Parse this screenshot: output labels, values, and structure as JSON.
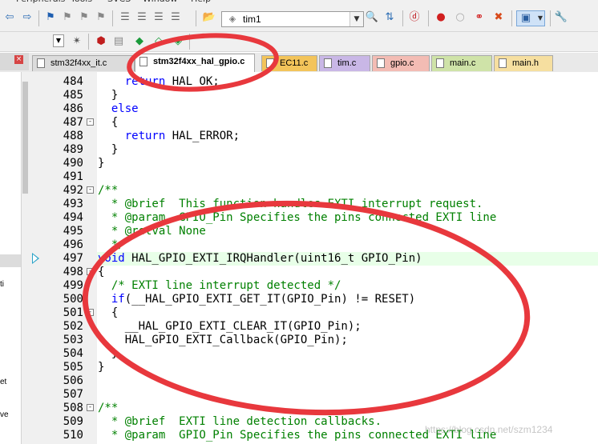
{
  "menubar": [
    "Peripherals",
    "Tools",
    "SVCS",
    "Window",
    "Help"
  ],
  "toolbar": {
    "target_value": "tim1"
  },
  "tabs": [
    {
      "label": "stm32f4xx_it.c",
      "color": "#dcdcdc"
    },
    {
      "label": "stm32f4xx_hal_gpio.c",
      "color": "#ffffff"
    },
    {
      "label": "EC11.c",
      "color": "#f3c45a"
    },
    {
      "label": "tim.c",
      "color": "#c9b7e6"
    },
    {
      "label": "gpio.c",
      "color": "#f3bcb4"
    },
    {
      "label": "main.c",
      "color": "#cfe3a8"
    },
    {
      "label": "main.h",
      "color": "#f6dfa0"
    }
  ],
  "left_panel": {
    "labels": [
      "ti",
      "et",
      "ve"
    ]
  },
  "code": {
    "lines": [
      {
        "n": "484",
        "fold": "",
        "segs": [
          {
            "c": "kw",
            "t": "    return"
          },
          {
            "c": "",
            "t": " HAL_OK;"
          }
        ]
      },
      {
        "n": "485",
        "fold": "",
        "segs": [
          {
            "c": "",
            "t": "  }"
          }
        ]
      },
      {
        "n": "486",
        "fold": "",
        "segs": [
          {
            "c": "kw",
            "t": "  else"
          }
        ]
      },
      {
        "n": "487",
        "fold": "-",
        "segs": [
          {
            "c": "",
            "t": "  {"
          }
        ]
      },
      {
        "n": "488",
        "fold": "",
        "segs": [
          {
            "c": "kw",
            "t": "    return"
          },
          {
            "c": "",
            "t": " HAL_ERROR;"
          }
        ]
      },
      {
        "n": "489",
        "fold": "",
        "segs": [
          {
            "c": "",
            "t": "  }"
          }
        ]
      },
      {
        "n": "490",
        "fold": "",
        "segs": [
          {
            "c": "",
            "t": "}"
          }
        ]
      },
      {
        "n": "491",
        "fold": "",
        "segs": []
      },
      {
        "n": "492",
        "fold": "-",
        "segs": [
          {
            "c": "cm",
            "t": "/**"
          }
        ]
      },
      {
        "n": "493",
        "fold": "",
        "segs": [
          {
            "c": "cm",
            "t": "  * @brief  This function handles EXTI interrupt request."
          }
        ]
      },
      {
        "n": "494",
        "fold": "",
        "segs": [
          {
            "c": "cm",
            "t": "  * @param  GPIO_Pin Specifies the pins connected EXTI line"
          }
        ]
      },
      {
        "n": "495",
        "fold": "",
        "segs": [
          {
            "c": "cm",
            "t": "  * @retval None"
          }
        ]
      },
      {
        "n": "496",
        "fold": "",
        "segs": [
          {
            "c": "cm",
            "t": "  */"
          }
        ]
      },
      {
        "n": "497",
        "fold": "",
        "hl": true,
        "segs": [
          {
            "c": "kw",
            "t": "void"
          },
          {
            "c": "",
            "t": " HAL_GPIO_EXTI_IRQHandler(uint16_t GPIO_Pin)"
          }
        ]
      },
      {
        "n": "498",
        "fold": "-",
        "segs": [
          {
            "c": "",
            "t": "{"
          }
        ]
      },
      {
        "n": "499",
        "fold": "",
        "segs": [
          {
            "c": "cm",
            "t": "  /* EXTI line interrupt detected */"
          }
        ]
      },
      {
        "n": "500",
        "fold": "",
        "segs": [
          {
            "c": "kw",
            "t": "  if"
          },
          {
            "c": "",
            "t": "(__HAL_GPIO_EXTI_GET_IT(GPIO_Pin) != RESET)"
          }
        ]
      },
      {
        "n": "501",
        "fold": "-",
        "segs": [
          {
            "c": "",
            "t": "  {"
          }
        ]
      },
      {
        "n": "502",
        "fold": "",
        "segs": [
          {
            "c": "",
            "t": "    __HAL_GPIO_EXTI_CLEAR_IT(GPIO_Pin);"
          }
        ]
      },
      {
        "n": "503",
        "fold": "",
        "segs": [
          {
            "c": "",
            "t": "    HAL_GPIO_EXTI_Callback(GPIO_Pin);"
          }
        ]
      },
      {
        "n": "504",
        "fold": "",
        "segs": [
          {
            "c": "",
            "t": "  }"
          }
        ]
      },
      {
        "n": "505",
        "fold": "",
        "segs": [
          {
            "c": "",
            "t": "}"
          }
        ]
      },
      {
        "n": "506",
        "fold": "",
        "segs": []
      },
      {
        "n": "507",
        "fold": "",
        "segs": []
      },
      {
        "n": "508",
        "fold": "-",
        "segs": [
          {
            "c": "cm",
            "t": "/**"
          }
        ]
      },
      {
        "n": "509",
        "fold": "",
        "segs": [
          {
            "c": "cm",
            "t": "  * @brief  EXTI line detection callbacks."
          }
        ]
      },
      {
        "n": "510",
        "fold": "",
        "segs": [
          {
            "c": "cm",
            "t": "  * @param  GPIO_Pin Specifies the pins connected EXTI line"
          }
        ]
      }
    ]
  },
  "watermark": "https://blog.csdn.net/szm1234",
  "annotation_color": "#e8383d"
}
